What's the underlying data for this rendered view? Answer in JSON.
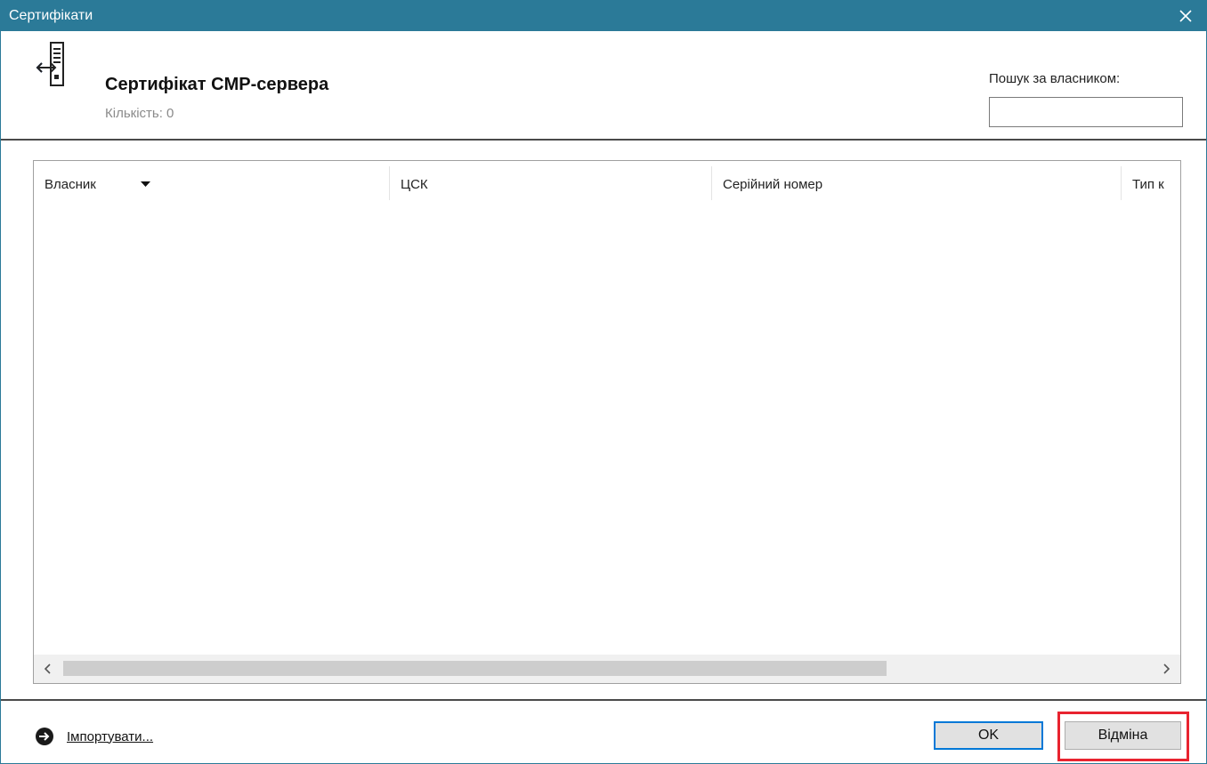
{
  "window": {
    "title": "Сертифікати"
  },
  "header": {
    "title": "Сертифікат CMP-сервера",
    "count": "Кількість: 0",
    "search_label": "Пошук за власником:",
    "search_value": ""
  },
  "table": {
    "columns": [
      {
        "label": "Власник",
        "sorted": "descending"
      },
      {
        "label": "ЦСК"
      },
      {
        "label": "Серійний номер"
      },
      {
        "label": "Тип к"
      }
    ],
    "rows": []
  },
  "footer": {
    "import_label": "Імпортувати...",
    "ok_label": "OK",
    "cancel_label": "Відміна"
  },
  "colors": {
    "titlebar": "#2b7a98",
    "ok_border": "#0078d7",
    "highlight": "#e8232f"
  },
  "icons": [
    "close-icon",
    "server-transfer-icon",
    "sort-down-icon",
    "chevron-left-icon",
    "chevron-right-icon",
    "import-arrow-icon"
  ]
}
